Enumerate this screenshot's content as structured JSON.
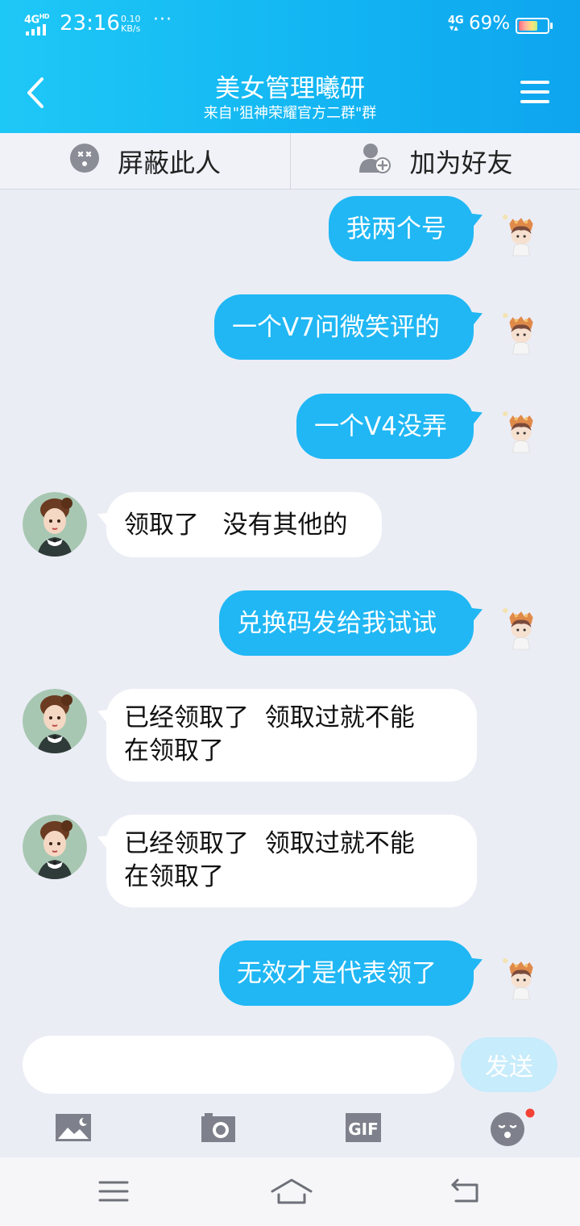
{
  "status_bar": {
    "network_label": "4G",
    "hd_label": "HD",
    "time": "23:16",
    "speed_value": "0.10",
    "speed_unit": "KB/s",
    "dots": "···",
    "net_type": "4G",
    "battery_percent": "69%",
    "battery_level": 0.69
  },
  "header": {
    "title": "美女管理曦研",
    "subtitle": "来自\"狙神荣耀官方二群\"群"
  },
  "actions": {
    "block_label": "屏蔽此人",
    "add_friend_label": "加为好友"
  },
  "messages": [
    {
      "side": "out",
      "text": "我两个号"
    },
    {
      "side": "out",
      "text": "一个V7问微笑评的"
    },
    {
      "side": "out",
      "text": "一个V4没弄"
    },
    {
      "side": "in",
      "text": "领取了   没有其他的"
    },
    {
      "side": "out",
      "text": "兑换码发给我试试"
    },
    {
      "side": "in",
      "line1": "已经领取了  领取过就不能",
      "line2": "在领取了"
    },
    {
      "side": "in",
      "line1": "已经领取了  领取过就不能",
      "line2": "在领取了"
    },
    {
      "side": "out",
      "text": "无效才是代表领了"
    }
  ],
  "composer": {
    "placeholder": "",
    "send_label": "发送",
    "gif_label": "GIF"
  },
  "colors": {
    "header_start": "#1ec8f6",
    "header_end": "#0ea5ef",
    "out_bubble": "#20b7f4",
    "in_bubble": "#ffffff",
    "background": "#ebedf5",
    "send_disabled": "#c7ecfb",
    "notification_dot": "#f44336"
  },
  "icons": {
    "back": "chevron-left-icon",
    "menu": "hamburger-menu-icon",
    "block": "block-face-icon",
    "add_friend": "add-user-icon",
    "image": "image-icon",
    "camera": "camera-icon",
    "gif": "gif-icon",
    "emoji": "emoji-icon",
    "nav_menu": "nav-menu-icon",
    "nav_home": "nav-home-icon",
    "nav_back": "nav-back-icon"
  }
}
